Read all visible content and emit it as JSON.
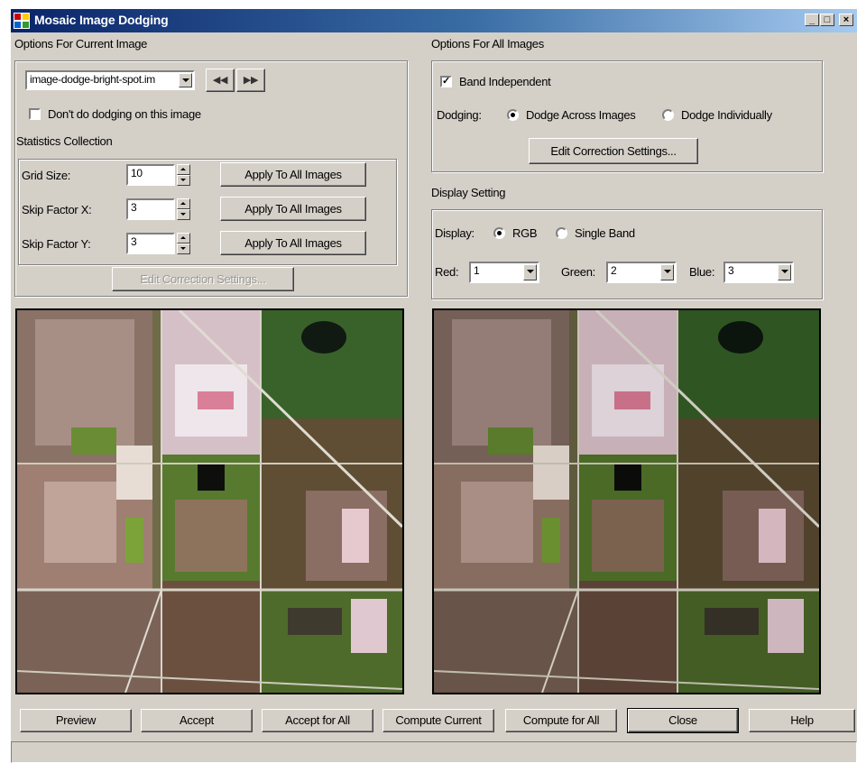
{
  "window": {
    "title": "Mosaic Image Dodging",
    "min_glyph": "_",
    "max_glyph": "□",
    "close_glyph": "×"
  },
  "current": {
    "section_label": "Options For Current Image",
    "image_select_value": "image-dodge-bright-spot.im",
    "prev_glyph": "◀◀",
    "next_glyph": "▶▶",
    "no_dodge_label": "Don't do dodging on this image",
    "no_dodge_checked": false,
    "stats_label": "Statistics Collection",
    "rows": [
      {
        "label": "Grid Size:",
        "value": "10",
        "button": "Apply To All Images"
      },
      {
        "label": "Skip Factor X:",
        "value": "3",
        "button": "Apply To All Images"
      },
      {
        "label": "Skip Factor Y:",
        "value": "3",
        "button": "Apply To All Images"
      }
    ],
    "edit_button": "Edit Correction Settings..."
  },
  "all": {
    "section_label": "Options For All Images",
    "band_independent_label": "Band Independent",
    "band_independent_checked": true,
    "check_glyph": "✓",
    "dodging_label": "Dodging:",
    "dodge_across_label": "Dodge Across Images",
    "dodge_individually_label": "Dodge Individually",
    "dodging_selected": "Dodge Across Images",
    "edit_button": "Edit Correction Settings..."
  },
  "display": {
    "section_label": "Display Setting",
    "display_label": "Display:",
    "rgb_label": "RGB",
    "single_band_label": "Single Band",
    "selected": "RGB",
    "red_label": "Red:",
    "red_value": "1",
    "green_label": "Green:",
    "green_value": "2",
    "blue_label": "Blue:",
    "blue_value": "3"
  },
  "buttons": {
    "preview": "Preview",
    "accept": "Accept",
    "accept_all": "Accept for All",
    "compute_current": "Compute Current",
    "compute_all": "Compute for All",
    "close": "Close",
    "help": "Help"
  },
  "colors": {
    "title_start": "#0a246a",
    "title_end": "#a6caf0",
    "face": "#d4d0c8"
  }
}
